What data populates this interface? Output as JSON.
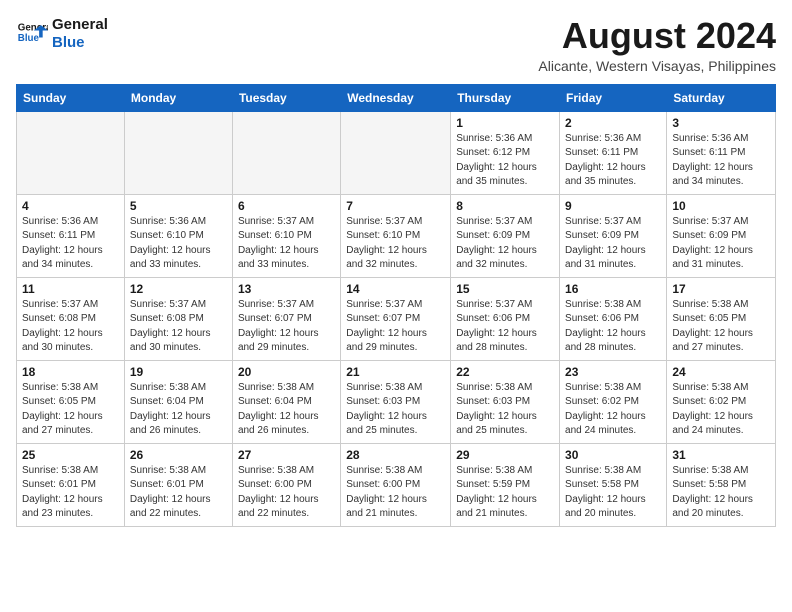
{
  "logo": {
    "line1": "General",
    "line2": "Blue"
  },
  "title": "August 2024",
  "location": "Alicante, Western Visayas, Philippines",
  "weekdays": [
    "Sunday",
    "Monday",
    "Tuesday",
    "Wednesday",
    "Thursday",
    "Friday",
    "Saturday"
  ],
  "weeks": [
    [
      {
        "day": "",
        "detail": ""
      },
      {
        "day": "",
        "detail": ""
      },
      {
        "day": "",
        "detail": ""
      },
      {
        "day": "",
        "detail": ""
      },
      {
        "day": "1",
        "detail": "Sunrise: 5:36 AM\nSunset: 6:12 PM\nDaylight: 12 hours\nand 35 minutes."
      },
      {
        "day": "2",
        "detail": "Sunrise: 5:36 AM\nSunset: 6:11 PM\nDaylight: 12 hours\nand 35 minutes."
      },
      {
        "day": "3",
        "detail": "Sunrise: 5:36 AM\nSunset: 6:11 PM\nDaylight: 12 hours\nand 34 minutes."
      }
    ],
    [
      {
        "day": "4",
        "detail": "Sunrise: 5:36 AM\nSunset: 6:11 PM\nDaylight: 12 hours\nand 34 minutes."
      },
      {
        "day": "5",
        "detail": "Sunrise: 5:36 AM\nSunset: 6:10 PM\nDaylight: 12 hours\nand 33 minutes."
      },
      {
        "day": "6",
        "detail": "Sunrise: 5:37 AM\nSunset: 6:10 PM\nDaylight: 12 hours\nand 33 minutes."
      },
      {
        "day": "7",
        "detail": "Sunrise: 5:37 AM\nSunset: 6:10 PM\nDaylight: 12 hours\nand 32 minutes."
      },
      {
        "day": "8",
        "detail": "Sunrise: 5:37 AM\nSunset: 6:09 PM\nDaylight: 12 hours\nand 32 minutes."
      },
      {
        "day": "9",
        "detail": "Sunrise: 5:37 AM\nSunset: 6:09 PM\nDaylight: 12 hours\nand 31 minutes."
      },
      {
        "day": "10",
        "detail": "Sunrise: 5:37 AM\nSunset: 6:09 PM\nDaylight: 12 hours\nand 31 minutes."
      }
    ],
    [
      {
        "day": "11",
        "detail": "Sunrise: 5:37 AM\nSunset: 6:08 PM\nDaylight: 12 hours\nand 30 minutes."
      },
      {
        "day": "12",
        "detail": "Sunrise: 5:37 AM\nSunset: 6:08 PM\nDaylight: 12 hours\nand 30 minutes."
      },
      {
        "day": "13",
        "detail": "Sunrise: 5:37 AM\nSunset: 6:07 PM\nDaylight: 12 hours\nand 29 minutes."
      },
      {
        "day": "14",
        "detail": "Sunrise: 5:37 AM\nSunset: 6:07 PM\nDaylight: 12 hours\nand 29 minutes."
      },
      {
        "day": "15",
        "detail": "Sunrise: 5:37 AM\nSunset: 6:06 PM\nDaylight: 12 hours\nand 28 minutes."
      },
      {
        "day": "16",
        "detail": "Sunrise: 5:38 AM\nSunset: 6:06 PM\nDaylight: 12 hours\nand 28 minutes."
      },
      {
        "day": "17",
        "detail": "Sunrise: 5:38 AM\nSunset: 6:05 PM\nDaylight: 12 hours\nand 27 minutes."
      }
    ],
    [
      {
        "day": "18",
        "detail": "Sunrise: 5:38 AM\nSunset: 6:05 PM\nDaylight: 12 hours\nand 27 minutes."
      },
      {
        "day": "19",
        "detail": "Sunrise: 5:38 AM\nSunset: 6:04 PM\nDaylight: 12 hours\nand 26 minutes."
      },
      {
        "day": "20",
        "detail": "Sunrise: 5:38 AM\nSunset: 6:04 PM\nDaylight: 12 hours\nand 26 minutes."
      },
      {
        "day": "21",
        "detail": "Sunrise: 5:38 AM\nSunset: 6:03 PM\nDaylight: 12 hours\nand 25 minutes."
      },
      {
        "day": "22",
        "detail": "Sunrise: 5:38 AM\nSunset: 6:03 PM\nDaylight: 12 hours\nand 25 minutes."
      },
      {
        "day": "23",
        "detail": "Sunrise: 5:38 AM\nSunset: 6:02 PM\nDaylight: 12 hours\nand 24 minutes."
      },
      {
        "day": "24",
        "detail": "Sunrise: 5:38 AM\nSunset: 6:02 PM\nDaylight: 12 hours\nand 24 minutes."
      }
    ],
    [
      {
        "day": "25",
        "detail": "Sunrise: 5:38 AM\nSunset: 6:01 PM\nDaylight: 12 hours\nand 23 minutes."
      },
      {
        "day": "26",
        "detail": "Sunrise: 5:38 AM\nSunset: 6:01 PM\nDaylight: 12 hours\nand 22 minutes."
      },
      {
        "day": "27",
        "detail": "Sunrise: 5:38 AM\nSunset: 6:00 PM\nDaylight: 12 hours\nand 22 minutes."
      },
      {
        "day": "28",
        "detail": "Sunrise: 5:38 AM\nSunset: 6:00 PM\nDaylight: 12 hours\nand 21 minutes."
      },
      {
        "day": "29",
        "detail": "Sunrise: 5:38 AM\nSunset: 5:59 PM\nDaylight: 12 hours\nand 21 minutes."
      },
      {
        "day": "30",
        "detail": "Sunrise: 5:38 AM\nSunset: 5:58 PM\nDaylight: 12 hours\nand 20 minutes."
      },
      {
        "day": "31",
        "detail": "Sunrise: 5:38 AM\nSunset: 5:58 PM\nDaylight: 12 hours\nand 20 minutes."
      }
    ]
  ]
}
